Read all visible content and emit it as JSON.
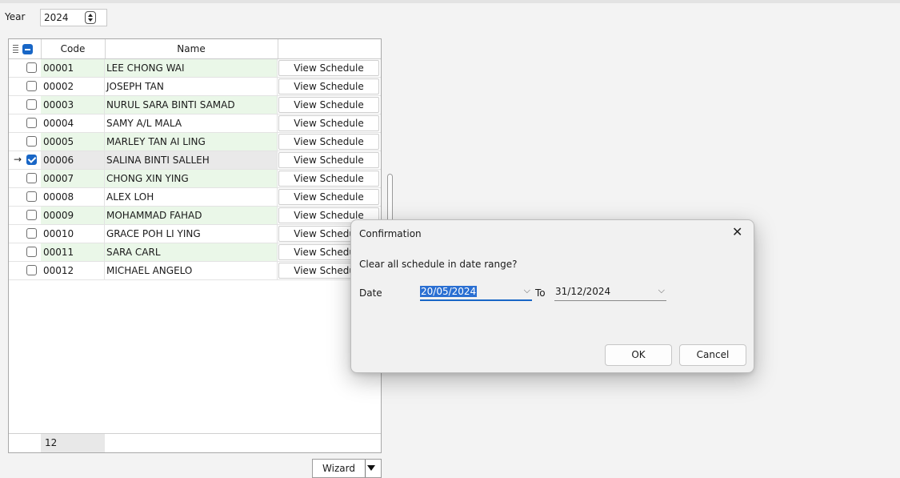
{
  "header": {
    "year_label": "Year",
    "year_value": "2024"
  },
  "grid": {
    "columns": {
      "code": "Code",
      "name": "Name"
    },
    "rows": [
      {
        "code": "00001",
        "name": "LEE CHONG WAI",
        "button": "View Schedule",
        "checked": false
      },
      {
        "code": "00002",
        "name": "JOSEPH TAN",
        "button": "View Schedule",
        "checked": false
      },
      {
        "code": "00003",
        "name": "NURUL SARA BINTI SAMAD",
        "button": "View Schedule",
        "checked": false
      },
      {
        "code": "00004",
        "name": "SAMY A/L MALA",
        "button": "View Schedule",
        "checked": false
      },
      {
        "code": "00005",
        "name": "MARLEY TAN AI LING",
        "button": "View Schedule",
        "checked": false
      },
      {
        "code": "00006",
        "name": "SALINA BINTI SALLEH",
        "button": "View Schedule",
        "checked": true,
        "current": true,
        "indicator": "→"
      },
      {
        "code": "00007",
        "name": "CHONG XIN YING",
        "button": "View Schedule",
        "checked": false
      },
      {
        "code": "00008",
        "name": "ALEX LOH",
        "button": "View Schedule",
        "checked": false
      },
      {
        "code": "00009",
        "name": "MOHAMMAD FAHAD",
        "button": "View Schedule",
        "checked": false
      },
      {
        "code": "00010",
        "name": "GRACE POH LI YING",
        "button": "View Schedule",
        "checked": false
      },
      {
        "code": "00011",
        "name": "SARA CARL",
        "button": "View Schedule",
        "checked": false
      },
      {
        "code": "00012",
        "name": "MICHAEL ANGELO",
        "button": "View Schedule",
        "checked": false
      }
    ],
    "footer_count": "12"
  },
  "wizard": {
    "label": "Wizard"
  },
  "dialog": {
    "title": "Confirmation",
    "close_glyph": "✕",
    "message": "Clear all schedule in date range?",
    "date_label": "Date",
    "date_from": "20/05/2024",
    "to_label": "To",
    "date_to": "31/12/2024",
    "chevron": "⌵",
    "ok_label": "OK",
    "cancel_label": "Cancel"
  },
  "colors": {
    "alt_row": "#eaf7e8",
    "accent": "#1866c6",
    "selection": "#2a6fd2"
  }
}
